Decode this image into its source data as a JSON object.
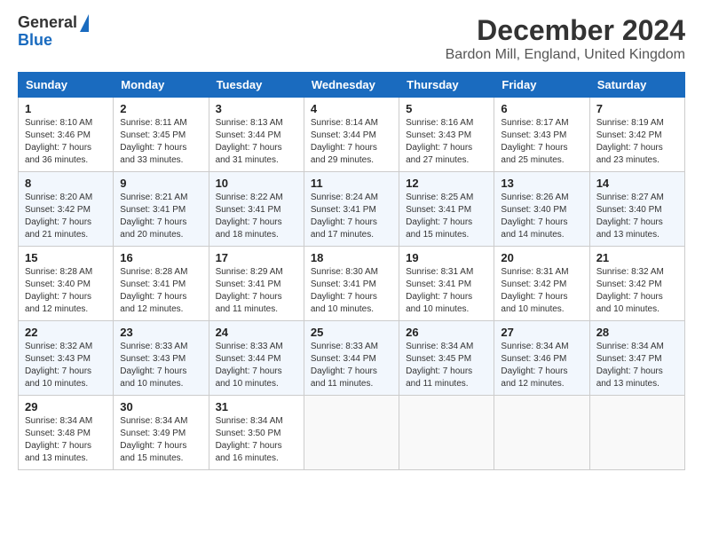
{
  "header": {
    "logo_general": "General",
    "logo_blue": "Blue",
    "title": "December 2024",
    "subtitle": "Bardon Mill, England, United Kingdom"
  },
  "calendar": {
    "days_of_week": [
      "Sunday",
      "Monday",
      "Tuesday",
      "Wednesday",
      "Thursday",
      "Friday",
      "Saturday"
    ],
    "weeks": [
      [
        {
          "day": "1",
          "sunrise": "8:10 AM",
          "sunset": "3:46 PM",
          "daylight": "7 hours and 36 minutes."
        },
        {
          "day": "2",
          "sunrise": "8:11 AM",
          "sunset": "3:45 PM",
          "daylight": "7 hours and 33 minutes."
        },
        {
          "day": "3",
          "sunrise": "8:13 AM",
          "sunset": "3:44 PM",
          "daylight": "7 hours and 31 minutes."
        },
        {
          "day": "4",
          "sunrise": "8:14 AM",
          "sunset": "3:44 PM",
          "daylight": "7 hours and 29 minutes."
        },
        {
          "day": "5",
          "sunrise": "8:16 AM",
          "sunset": "3:43 PM",
          "daylight": "7 hours and 27 minutes."
        },
        {
          "day": "6",
          "sunrise": "8:17 AM",
          "sunset": "3:43 PM",
          "daylight": "7 hours and 25 minutes."
        },
        {
          "day": "7",
          "sunrise": "8:19 AM",
          "sunset": "3:42 PM",
          "daylight": "7 hours and 23 minutes."
        }
      ],
      [
        {
          "day": "8",
          "sunrise": "8:20 AM",
          "sunset": "3:42 PM",
          "daylight": "7 hours and 21 minutes."
        },
        {
          "day": "9",
          "sunrise": "8:21 AM",
          "sunset": "3:41 PM",
          "daylight": "7 hours and 20 minutes."
        },
        {
          "day": "10",
          "sunrise": "8:22 AM",
          "sunset": "3:41 PM",
          "daylight": "7 hours and 18 minutes."
        },
        {
          "day": "11",
          "sunrise": "8:24 AM",
          "sunset": "3:41 PM",
          "daylight": "7 hours and 17 minutes."
        },
        {
          "day": "12",
          "sunrise": "8:25 AM",
          "sunset": "3:41 PM",
          "daylight": "7 hours and 15 minutes."
        },
        {
          "day": "13",
          "sunrise": "8:26 AM",
          "sunset": "3:40 PM",
          "daylight": "7 hours and 14 minutes."
        },
        {
          "day": "14",
          "sunrise": "8:27 AM",
          "sunset": "3:40 PM",
          "daylight": "7 hours and 13 minutes."
        }
      ],
      [
        {
          "day": "15",
          "sunrise": "8:28 AM",
          "sunset": "3:40 PM",
          "daylight": "7 hours and 12 minutes."
        },
        {
          "day": "16",
          "sunrise": "8:28 AM",
          "sunset": "3:41 PM",
          "daylight": "7 hours and 12 minutes."
        },
        {
          "day": "17",
          "sunrise": "8:29 AM",
          "sunset": "3:41 PM",
          "daylight": "7 hours and 11 minutes."
        },
        {
          "day": "18",
          "sunrise": "8:30 AM",
          "sunset": "3:41 PM",
          "daylight": "7 hours and 10 minutes."
        },
        {
          "day": "19",
          "sunrise": "8:31 AM",
          "sunset": "3:41 PM",
          "daylight": "7 hours and 10 minutes."
        },
        {
          "day": "20",
          "sunrise": "8:31 AM",
          "sunset": "3:42 PM",
          "daylight": "7 hours and 10 minutes."
        },
        {
          "day": "21",
          "sunrise": "8:32 AM",
          "sunset": "3:42 PM",
          "daylight": "7 hours and 10 minutes."
        }
      ],
      [
        {
          "day": "22",
          "sunrise": "8:32 AM",
          "sunset": "3:43 PM",
          "daylight": "7 hours and 10 minutes."
        },
        {
          "day": "23",
          "sunrise": "8:33 AM",
          "sunset": "3:43 PM",
          "daylight": "7 hours and 10 minutes."
        },
        {
          "day": "24",
          "sunrise": "8:33 AM",
          "sunset": "3:44 PM",
          "daylight": "7 hours and 10 minutes."
        },
        {
          "day": "25",
          "sunrise": "8:33 AM",
          "sunset": "3:44 PM",
          "daylight": "7 hours and 11 minutes."
        },
        {
          "day": "26",
          "sunrise": "8:34 AM",
          "sunset": "3:45 PM",
          "daylight": "7 hours and 11 minutes."
        },
        {
          "day": "27",
          "sunrise": "8:34 AM",
          "sunset": "3:46 PM",
          "daylight": "7 hours and 12 minutes."
        },
        {
          "day": "28",
          "sunrise": "8:34 AM",
          "sunset": "3:47 PM",
          "daylight": "7 hours and 13 minutes."
        }
      ],
      [
        {
          "day": "29",
          "sunrise": "8:34 AM",
          "sunset": "3:48 PM",
          "daylight": "7 hours and 13 minutes."
        },
        {
          "day": "30",
          "sunrise": "8:34 AM",
          "sunset": "3:49 PM",
          "daylight": "7 hours and 15 minutes."
        },
        {
          "day": "31",
          "sunrise": "8:34 AM",
          "sunset": "3:50 PM",
          "daylight": "7 hours and 16 minutes."
        },
        null,
        null,
        null,
        null
      ]
    ]
  }
}
